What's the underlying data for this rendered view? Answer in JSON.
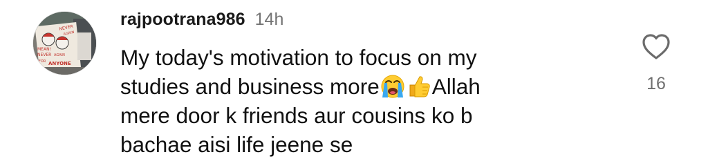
{
  "comment": {
    "username": "rajpootrana986",
    "time": "14h",
    "lines": [
      "My today's motivation to focus on my",
      "studies and business more",
      "Allah",
      "mere door k friends aur cousins ko b",
      "bachae aisi life jeene se"
    ],
    "emojis": [
      "loudly-crying-face-emoji",
      "thumbs-up-emoji"
    ],
    "like_count": "16"
  },
  "avatar_sign_text": [
    "NEVER",
    "AGAIN",
    "MEAN!",
    "NEVER",
    "AGAIN",
    "FOR",
    "ANYONE"
  ],
  "colors": {
    "username": "#1a1a1a",
    "time": "#737373",
    "text": "#111111",
    "like_count": "#6f6f6f"
  }
}
